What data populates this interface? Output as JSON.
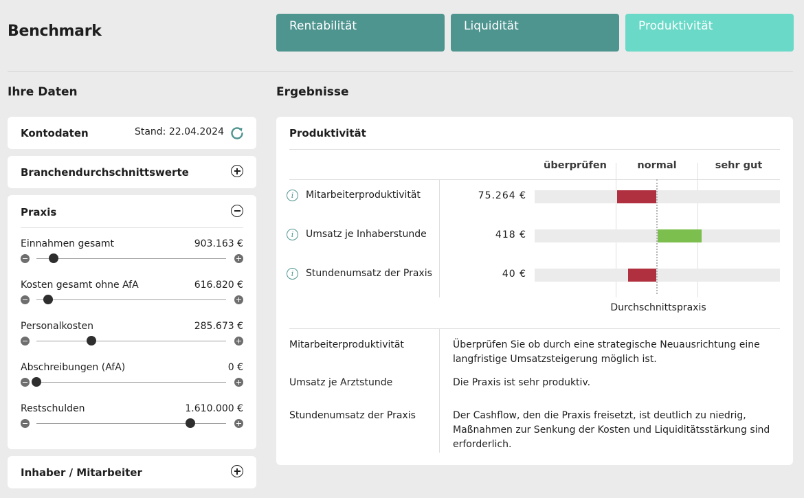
{
  "header": {
    "title": "Benchmark"
  },
  "tabs": [
    {
      "label": "Rentabilität",
      "active": false
    },
    {
      "label": "Liquidität",
      "active": false
    },
    {
      "label": "Produktivität",
      "active": true
    }
  ],
  "colors": {
    "tab": "#4e948f",
    "tab_active": "#6ad9c8",
    "bad": "#b0303f",
    "good": "#7cbf4f",
    "accent": "#4e948f"
  },
  "left": {
    "title": "Ihre Daten",
    "kontodaten": {
      "label": "Kontodaten",
      "stand": "Stand: 22.04.2024",
      "icon": "refresh-icon"
    },
    "branche": {
      "label": "Branchendurchschnittswerte",
      "icon": "plus-circle-icon"
    },
    "praxis": {
      "label": "Praxis",
      "icon": "minus-circle-icon",
      "rows": [
        {
          "label": "Einnahmen gesamt",
          "value": "903.163 €",
          "slider_fraction": 0.09
        },
        {
          "label": "Kosten gesamt ohne AfA",
          "value": "616.820 €",
          "slider_fraction": 0.06
        },
        {
          "label": "Personalkosten",
          "value": "285.673 €",
          "slider_fraction": 0.29
        },
        {
          "label": "Abschreibungen (AfA)",
          "value": "0 €",
          "slider_fraction": 0.0
        },
        {
          "label": "Restschulden",
          "value": "1.610.000 €",
          "slider_fraction": 0.81
        }
      ]
    },
    "inhaber": {
      "label": "Inhaber / Mitarbeiter",
      "icon": "plus-circle-icon"
    }
  },
  "results": {
    "title": "Ergebnisse",
    "card_title": "Produktivität",
    "columns": [
      "überprüfen",
      "normal",
      "sehr gut"
    ],
    "kpis": [
      {
        "label": "Mitarbeiterproduktivität",
        "value": "75.264 €",
        "deviation": -0.32,
        "status": "bad"
      },
      {
        "label": "Umsatz je Inhaberstunde",
        "value": "418 €",
        "deviation": 0.36,
        "status": "good"
      },
      {
        "label": "Stundenumsatz der Praxis",
        "value": "40 €",
        "deviation": -0.23,
        "status": "bad"
      }
    ],
    "avg_label": "Durchschnittspraxis",
    "texts": [
      {
        "label": "Mitarbeiterproduktivität",
        "text": "Überprüfen Sie ob durch eine strategische Neuausrichtung eine langfristige Umsatzsteigerung möglich ist."
      },
      {
        "label": "Umsatz je Arztstunde",
        "text": "Die Praxis ist sehr produktiv."
      },
      {
        "label": "Stundenumsatz der Praxis",
        "text": "Der Cashflow, den die Praxis freisetzt, ist deutlich zu niedrig, Maßnahmen zur Senkung der Kosten und Liquiditätsstärkung sind erforderlich."
      }
    ]
  }
}
